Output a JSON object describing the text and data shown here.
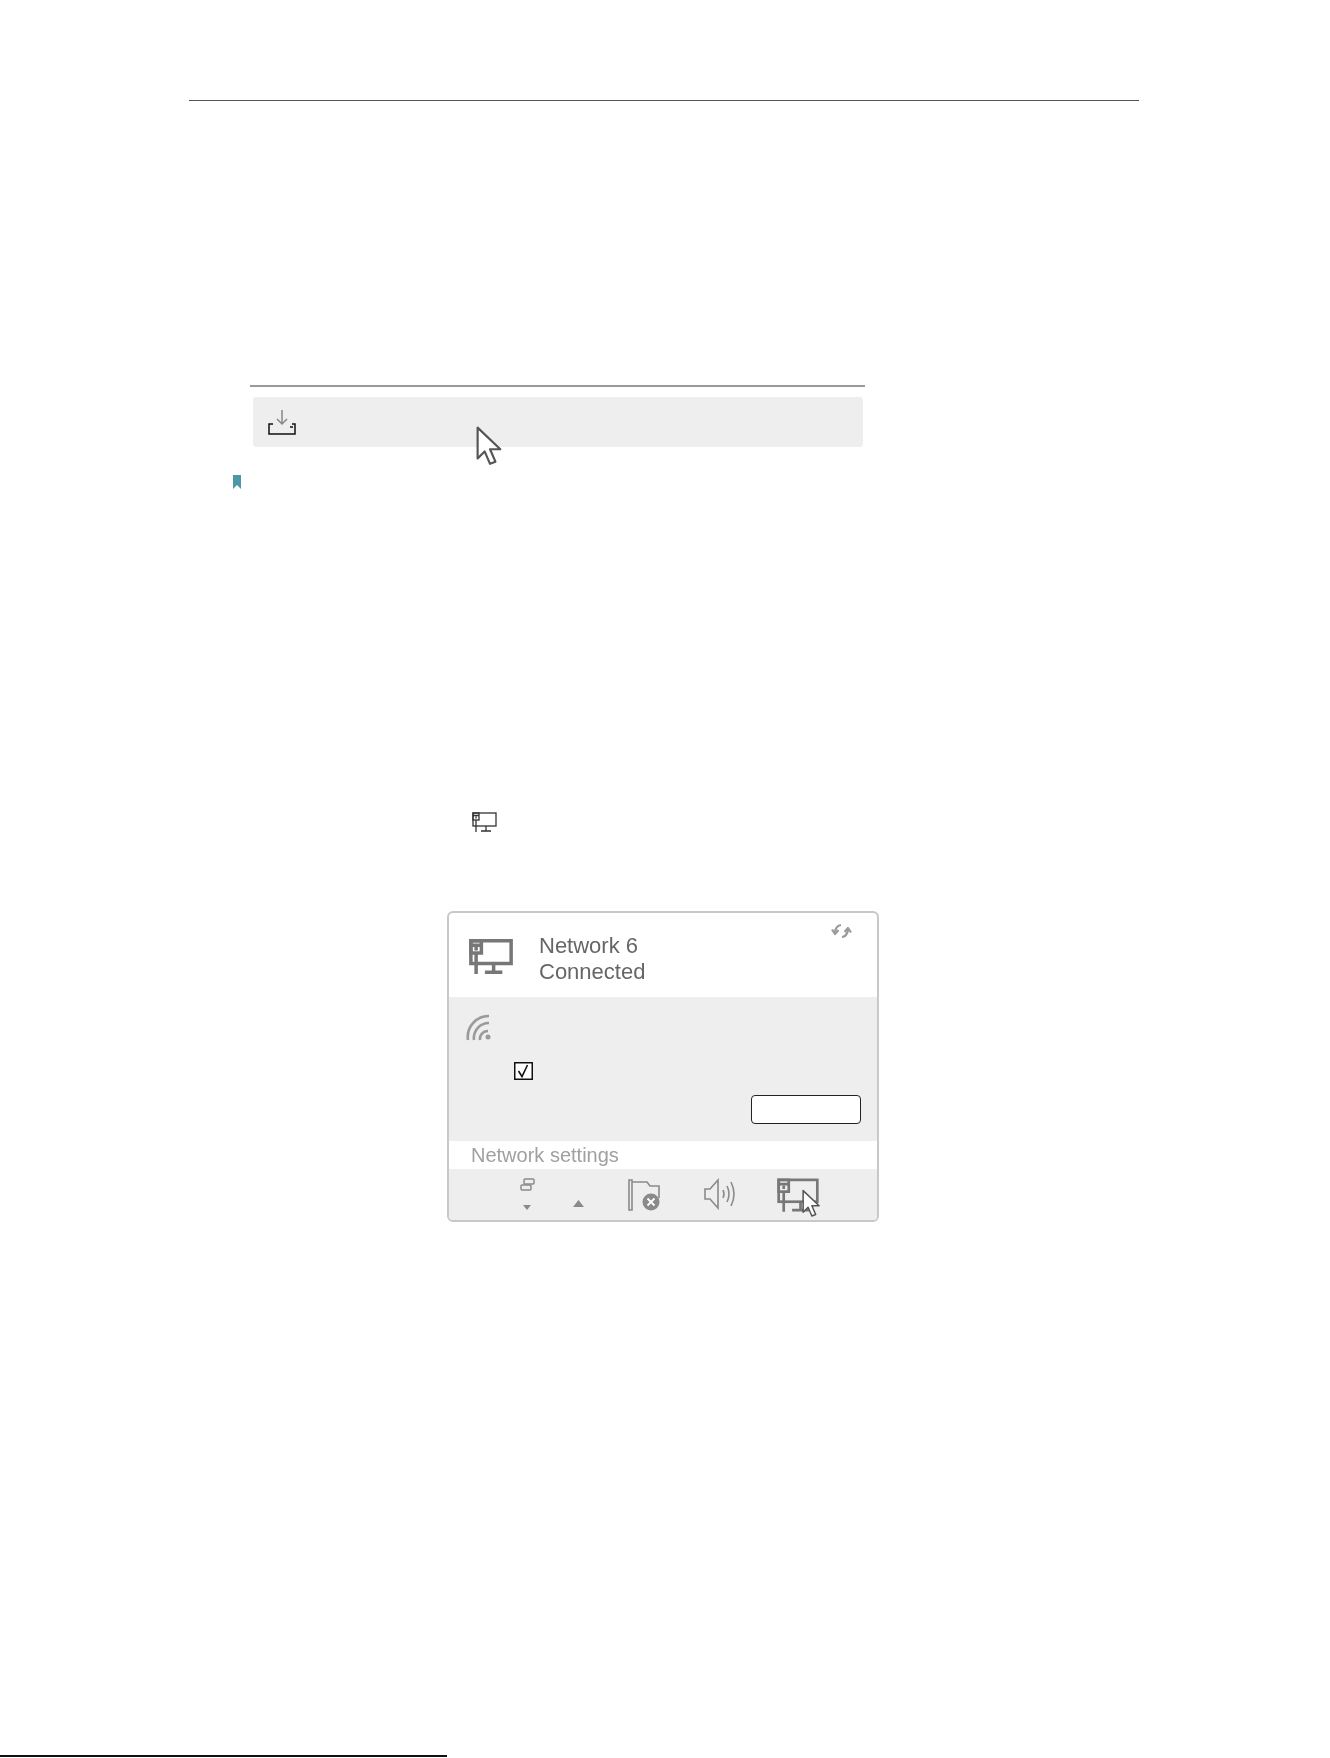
{
  "network_panel": {
    "name": "Network 6",
    "status": "Connected",
    "checkbox": {
      "checked": true
    },
    "settings_link": "Network settings"
  }
}
